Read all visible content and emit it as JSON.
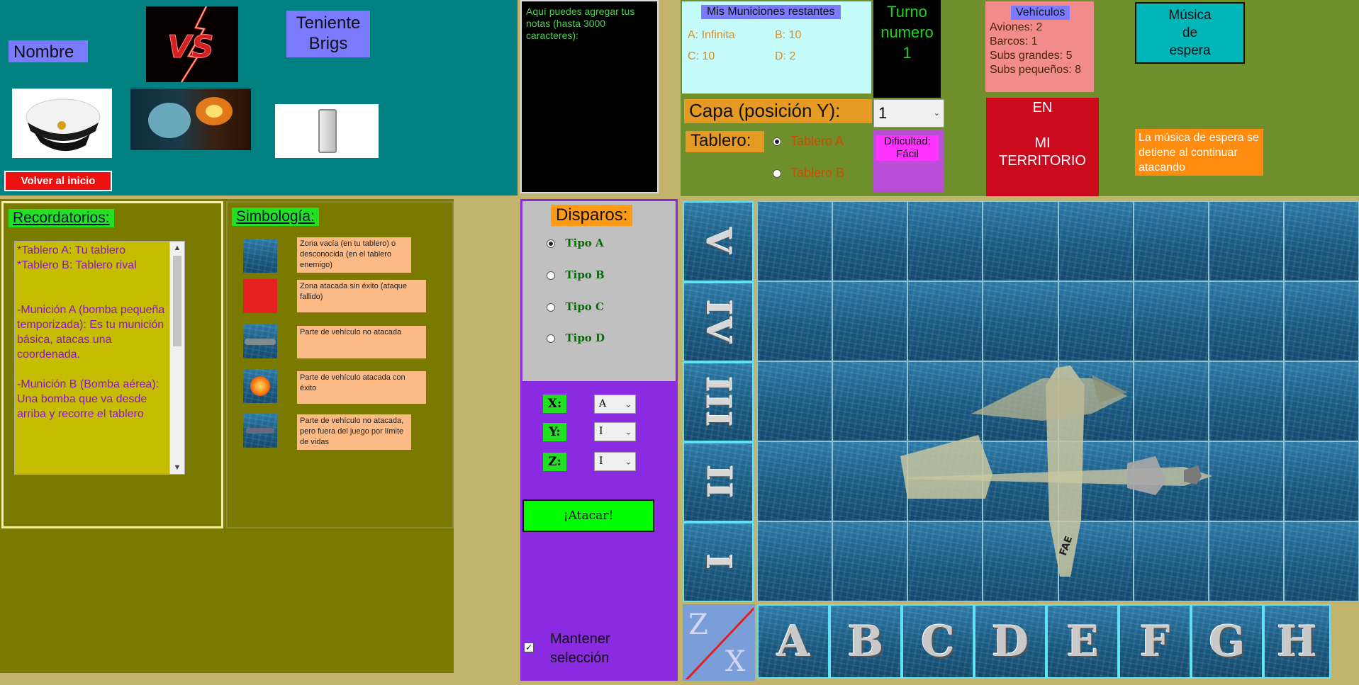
{
  "header": {
    "nombre_label": "Nombre",
    "rank_label": "Teniente\nBrigs",
    "back_button": "Volver al inicio"
  },
  "notes": {
    "placeholder": "Aquí puedes agregar tus notas (hasta 3000 caracteres):"
  },
  "ammo": {
    "title": "Mis Municiones restantes",
    "items": [
      "A: Infinita",
      "B: 10",
      "C: 10",
      "D: 2"
    ]
  },
  "turn": {
    "label": "Turno\nnumero",
    "value": "1"
  },
  "layer": {
    "label": "Capa (posición Y):",
    "selected": "1"
  },
  "board_select": {
    "label": "Tablero:",
    "options": [
      "Tablero A",
      "Tablero B"
    ],
    "selected": "Tablero A"
  },
  "difficulty": {
    "label": "Dificultad:\nFácil"
  },
  "vehicles": {
    "title": "Vehículos",
    "items": [
      "Aviones: 2",
      "Barcos: 1",
      "Subs grandes: 5",
      "Subs pequeños: 8"
    ]
  },
  "territory": {
    "text": "EN\n\nMI\nTERRITORIO"
  },
  "music": {
    "button": "Música\nde\nespera",
    "note": "La música de espera se detiene al continuar atacando"
  },
  "reminders": {
    "title": "Recordatorios:",
    "text": "*Tablero A: Tu tablero\n*Tablero B: Tablero rival\n\n\n-Munición A (bomba pequeña temporizada): Es tu munición\nbásica, atacas una coordenada.\n\n-Munición B (Bomba aérea):\nUna bomba que va desde arriba y recorre el tablero"
  },
  "symbology": {
    "title": "Simbología:",
    "items": [
      "Zona vacía (en tu tablero) o desconocida (en el tablero enemigo)",
      "Zona atacada sin éxito (ataque fallido)",
      "Parte de vehículo no atacada",
      "Parte de vehículo atacada con éxito",
      "Parte de vehículo no atacada, pero fuera del juego por límite de vidas"
    ]
  },
  "shots": {
    "title": "Disparos:",
    "options": [
      "Tipo A",
      "Tipo B",
      "Tipo C",
      "Tipo D"
    ],
    "selected": "Tipo A",
    "x_label": "X:",
    "x_value": "A",
    "y_label": "Y:",
    "y_value": "I",
    "z_label": "Z:",
    "z_value": "I",
    "attack_button": "¡Atacar!",
    "keep_selection": "Mantener\nselección",
    "keep_checked": true
  },
  "board": {
    "y_labels": [
      "V",
      "IV",
      "III",
      "II",
      "I"
    ],
    "x_labels": [
      "A",
      "B",
      "C",
      "D",
      "E",
      "F",
      "G",
      "H"
    ],
    "corner_z": "Z",
    "corner_x": "X",
    "plane_marking": "FAE"
  },
  "colors": {
    "teal": "#008080",
    "olive": "#6f8f2c",
    "dark_olive": "#7a7a00",
    "purple": "#8a2be2",
    "attack_green": "#00ff00",
    "territory_red": "#cc0a1e",
    "music_button": "#00b6b8"
  }
}
